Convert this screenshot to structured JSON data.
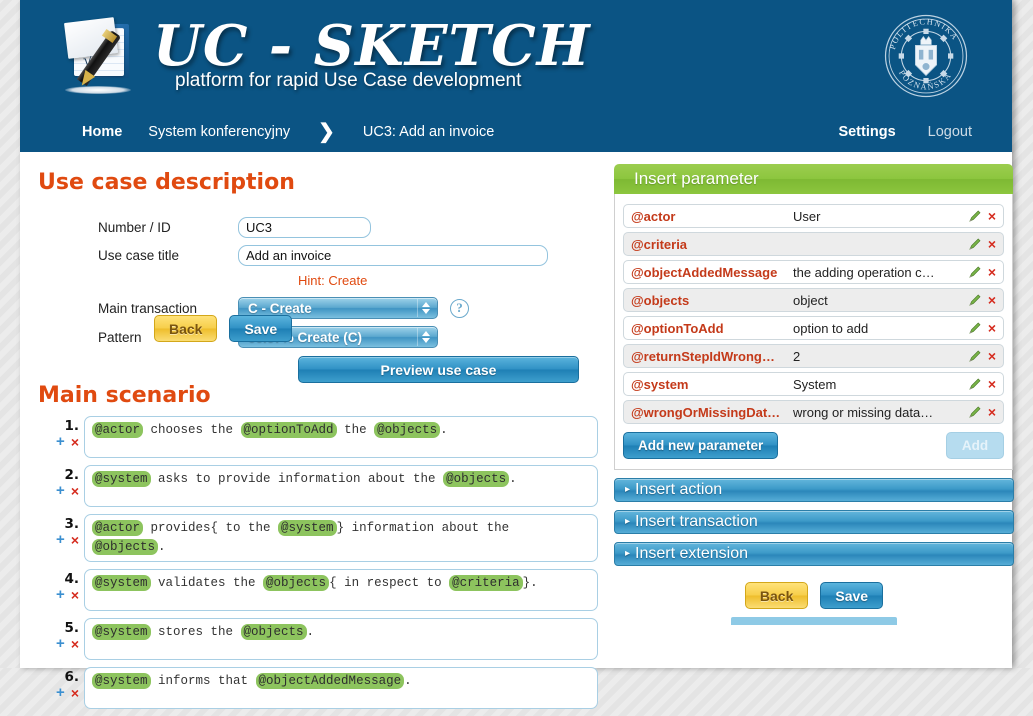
{
  "brand": {
    "title": "UC - SKETCH",
    "subtitle": "platform for rapid Use Case development",
    "university_logo_top": "POLITECHNIKA",
    "university_logo_bottom": "POZNAŃSKA"
  },
  "nav": {
    "home": "Home",
    "project": "System konferencyjny",
    "current": "UC3: Add an invoice",
    "settings": "Settings",
    "logout": "Logout"
  },
  "main": {
    "section_title": "Use case description",
    "labels": {
      "number_id": "Number / ID",
      "use_case_title": "Use case title",
      "main_transaction": "Main transaction",
      "pattern": "Pattern"
    },
    "values": {
      "number_id": "UC3",
      "use_case_title": "Add an invoice",
      "hint": "Hint: Create",
      "main_transaction": "C - Create",
      "pattern": "66.67% Create (C)"
    },
    "preview_button": "Preview use case",
    "help_icon": "?"
  },
  "scenario": {
    "title": "Main scenario",
    "steps": [
      {
        "num": "1.",
        "parts": [
          {
            "t": "@actor",
            "tag": true
          },
          {
            "t": " chooses the ",
            "tag": false
          },
          {
            "t": "@optionToAdd",
            "tag": true
          },
          {
            "t": " the ",
            "tag": false
          },
          {
            "t": "@objects",
            "tag": true
          },
          {
            "t": ".",
            "tag": false
          }
        ]
      },
      {
        "num": "2.",
        "parts": [
          {
            "t": "@system",
            "tag": true
          },
          {
            "t": " asks to provide information about the ",
            "tag": false
          },
          {
            "t": "@objects",
            "tag": true
          },
          {
            "t": ".",
            "tag": false
          }
        ]
      },
      {
        "num": "3.",
        "parts": [
          {
            "t": "@actor",
            "tag": true
          },
          {
            "t": " provides{ to the ",
            "tag": false
          },
          {
            "t": "@system",
            "tag": true
          },
          {
            "t": "} information about the ",
            "tag": false
          },
          {
            "t": "@objects",
            "tag": true
          },
          {
            "t": ".",
            "tag": false
          }
        ]
      },
      {
        "num": "4.",
        "parts": [
          {
            "t": "@system",
            "tag": true
          },
          {
            "t": " validates the ",
            "tag": false
          },
          {
            "t": "@objects",
            "tag": true
          },
          {
            "t": "{ in respect to ",
            "tag": false
          },
          {
            "t": "@criteria",
            "tag": true
          },
          {
            "t": "}.",
            "tag": false
          }
        ]
      },
      {
        "num": "5.",
        "parts": [
          {
            "t": "@system",
            "tag": true
          },
          {
            "t": " stores the ",
            "tag": false
          },
          {
            "t": "@objects",
            "tag": true
          },
          {
            "t": ".",
            "tag": false
          }
        ]
      },
      {
        "num": "6.",
        "parts": [
          {
            "t": "@system",
            "tag": true
          },
          {
            "t": " informs that ",
            "tag": false
          },
          {
            "t": "@objectAddedMessage",
            "tag": true
          },
          {
            "t": ".",
            "tag": false
          }
        ]
      }
    ],
    "add_icon": "+",
    "delete_icon": "×"
  },
  "insert_parameter": {
    "header": "Insert parameter",
    "rows": [
      {
        "name": "@actor",
        "value": "User"
      },
      {
        "name": "@criteria",
        "value": ""
      },
      {
        "name": "@objectAddedMessage",
        "value": "the adding operation c…"
      },
      {
        "name": "@objects",
        "value": "object"
      },
      {
        "name": "@optionToAdd",
        "value": "option to add"
      },
      {
        "name": "@returnStepIdWrong…",
        "value": "2"
      },
      {
        "name": "@system",
        "value": "System"
      },
      {
        "name": "@wrongOrMissingDat…",
        "value": "wrong or missing data…"
      }
    ],
    "add_new_button": "Add new parameter",
    "add_button": "Add",
    "edit_icon": "pencil-icon",
    "delete_icon": "×"
  },
  "accordions": [
    {
      "label": "Insert action",
      "caret": "▸"
    },
    {
      "label": "Insert transaction",
      "caret": "▸"
    },
    {
      "label": "Insert extension",
      "caret": "▸"
    }
  ],
  "buttons": {
    "back": "Back",
    "save": "Save"
  },
  "colors": {
    "header_blue": "#0b5484",
    "accent_orange": "#e04a10",
    "panel_green": "#8cc63e",
    "param_name_red": "#c43a1a",
    "tag_green": "#8dc45e",
    "button_blue": "#2f90c4",
    "button_yellow": "#f7cf4b"
  }
}
